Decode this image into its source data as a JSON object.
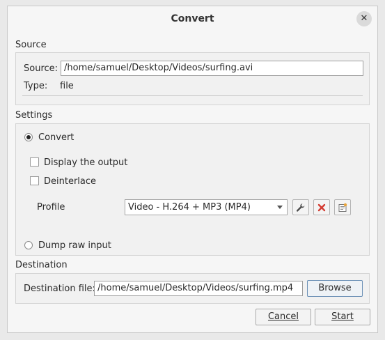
{
  "window": {
    "title": "Convert"
  },
  "source": {
    "section_label": "Source",
    "source_label": "Source:",
    "source_value": "/home/samuel/Desktop/Videos/surfing.avi",
    "type_label": "Type:",
    "type_value": "file"
  },
  "settings": {
    "section_label": "Settings",
    "convert_label": "Convert",
    "convert_selected": true,
    "display_output_label": "Display the output",
    "display_output_checked": false,
    "deinterlace_label": "Deinterlace",
    "deinterlace_checked": false,
    "profile_label": "Profile",
    "profile_value": "Video - H.264 + MP3 (MP4)",
    "dump_raw_label": "Dump raw input",
    "dump_raw_selected": false
  },
  "destination": {
    "section_label": "Destination",
    "file_label": "Destination file:",
    "file_value": "/home/samuel/Desktop/Videos/surfing.mp4",
    "browse_label": "Browse"
  },
  "buttons": {
    "cancel_label": "Cancel",
    "start_label": "Start"
  },
  "colors": {
    "delete_red": "#d33c32",
    "tool_blue": "#4b6f95"
  }
}
